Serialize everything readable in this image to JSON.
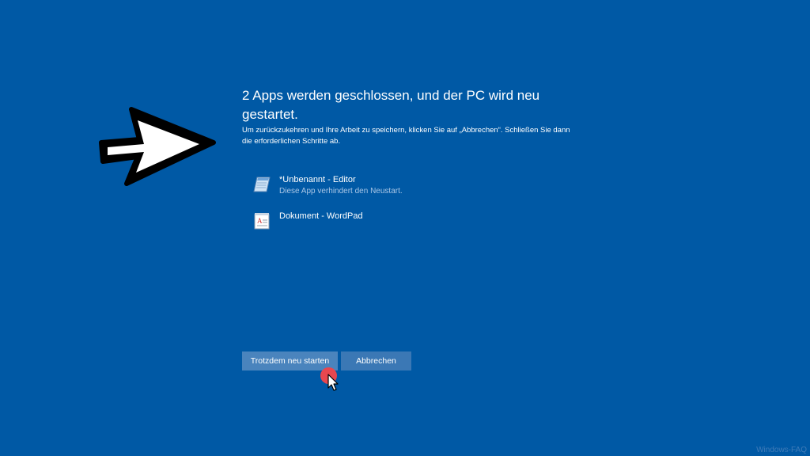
{
  "dialog": {
    "title": "2 Apps werden geschlossen, und der PC wird neu gestartet.",
    "subtitle": "Um zurückzukehren und Ihre Arbeit zu speichern, klicken Sie auf „Abbrechen“. Schließen Sie dann die erforderlichen Schritte ab."
  },
  "apps": [
    {
      "name": "*Unbenannt - Editor",
      "status": "Diese App verhindert den Neustart.",
      "icon": "notepad-icon"
    },
    {
      "name": "Dokument - WordPad",
      "status": "",
      "icon": "wordpad-icon"
    }
  ],
  "buttons": {
    "restart_label": "Trotzdem neu starten",
    "cancel_label": "Abbrechen"
  },
  "watermark": "Windows-FAQ",
  "colors": {
    "background": "#0059a5",
    "button": "#3b78b5",
    "status_text": "#a9c6e6",
    "click_indicator": "#e8474f"
  }
}
